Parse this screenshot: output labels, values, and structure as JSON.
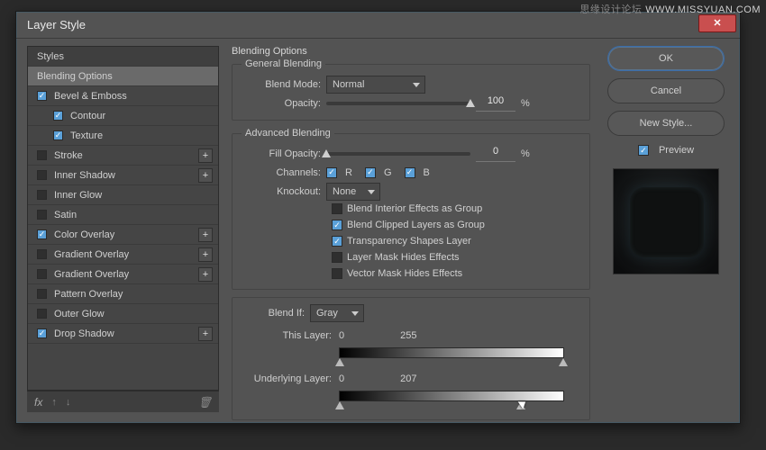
{
  "watermark": {
    "left": "思缘设计论坛",
    "right": "WWW.MISSYUAN.COM"
  },
  "dialog_title": "Layer Style",
  "left": {
    "header": "Styles",
    "items": [
      {
        "label": "Blending Options",
        "checked": null,
        "selected": true,
        "indent": false,
        "plus": false
      },
      {
        "label": "Bevel & Emboss",
        "checked": true,
        "indent": false,
        "plus": false
      },
      {
        "label": "Contour",
        "checked": true,
        "indent": true,
        "plus": false
      },
      {
        "label": "Texture",
        "checked": true,
        "indent": true,
        "plus": false
      },
      {
        "label": "Stroke",
        "checked": false,
        "indent": false,
        "plus": true
      },
      {
        "label": "Inner Shadow",
        "checked": false,
        "indent": false,
        "plus": true
      },
      {
        "label": "Inner Glow",
        "checked": false,
        "indent": false,
        "plus": false
      },
      {
        "label": "Satin",
        "checked": false,
        "indent": false,
        "plus": false
      },
      {
        "label": "Color Overlay",
        "checked": true,
        "indent": false,
        "plus": true
      },
      {
        "label": "Gradient Overlay",
        "checked": false,
        "indent": false,
        "plus": true
      },
      {
        "label": "Gradient Overlay",
        "checked": false,
        "indent": false,
        "plus": true
      },
      {
        "label": "Pattern Overlay",
        "checked": false,
        "indent": false,
        "plus": false
      },
      {
        "label": "Outer Glow",
        "checked": false,
        "indent": false,
        "plus": false
      },
      {
        "label": "Drop Shadow",
        "checked": true,
        "indent": false,
        "plus": true
      }
    ],
    "footer_fx": "fx"
  },
  "center": {
    "heading": "Blending Options",
    "general": {
      "legend": "General Blending",
      "blend_mode_label": "Blend Mode:",
      "blend_mode_value": "Normal",
      "opacity_label": "Opacity:",
      "opacity_value": "100",
      "opacity_pct": "%"
    },
    "advanced": {
      "legend": "Advanced Blending",
      "fill_opacity_label": "Fill Opacity:",
      "fill_opacity_value": "0",
      "fill_opacity_pct": "%",
      "channels_label": "Channels:",
      "ch_r": "R",
      "ch_g": "G",
      "ch_b": "B",
      "knockout_label": "Knockout:",
      "knockout_value": "None",
      "opt1": "Blend Interior Effects as Group",
      "opt2": "Blend Clipped Layers as Group",
      "opt3": "Transparency Shapes Layer",
      "opt4": "Layer Mask Hides Effects",
      "opt5": "Vector Mask Hides Effects"
    },
    "blendif": {
      "label": "Blend If:",
      "value": "Gray",
      "this_layer_label": "This Layer:",
      "this_low": "0",
      "this_high": "255",
      "under_label": "Underlying Layer:",
      "under_low": "0",
      "under_high": "207"
    }
  },
  "right": {
    "ok": "OK",
    "cancel": "Cancel",
    "new_style": "New Style...",
    "preview": "Preview"
  }
}
